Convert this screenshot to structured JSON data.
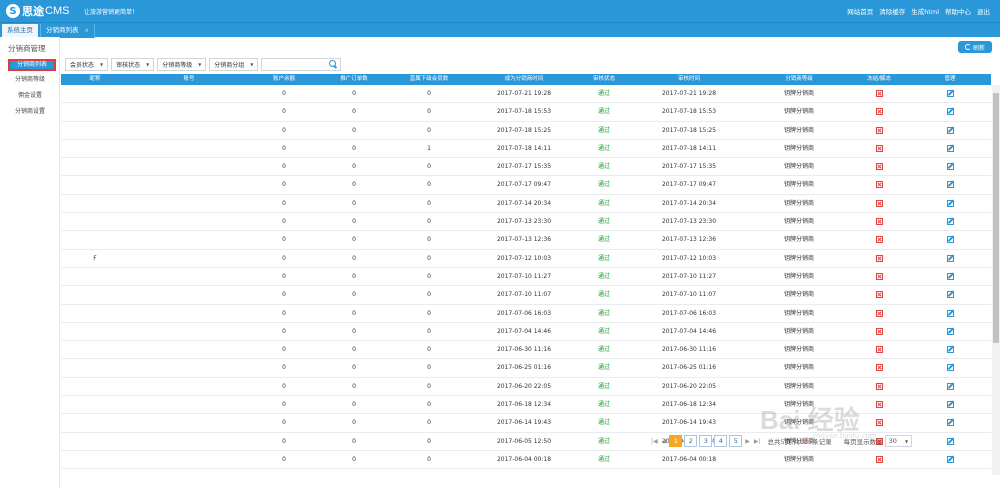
{
  "app": {
    "brand_cn": "思途",
    "brand_en": "CMS",
    "slogan": "让旅游营销更简单！",
    "top_links": [
      "网站首页",
      "清除缓存",
      "生成html",
      "帮助中心",
      "退出"
    ]
  },
  "tabs": [
    {
      "label": "系统主页"
    },
    {
      "label": "分销商列表",
      "close": "×"
    }
  ],
  "sidebar": {
    "title": "分销商管理",
    "items": [
      {
        "label": "分销商列表",
        "active": true
      },
      {
        "label": "分销商等级"
      },
      {
        "label": "佣金设置"
      },
      {
        "label": "分销商设置"
      }
    ]
  },
  "toolbar": {
    "refresh_label": "刷新",
    "filters": [
      "会员状态",
      "审核状态",
      "分销商等级",
      "分销商分组"
    ],
    "search_placeholder": ""
  },
  "table": {
    "headers": [
      "昵称",
      "账号",
      "账户余额",
      "推广订单数",
      "直属下级会员数",
      "成为分销商时间",
      "审核状态",
      "审核时间",
      "分销商等级",
      "冻结/解冻",
      "管理"
    ],
    "rows": [
      {
        "nick": "",
        "account": "",
        "balance": "0",
        "orders": "0",
        "subs": "0",
        "joined": "2017-07-21 19:28",
        "status": "通过",
        "audit": "2017-07-21 19:28",
        "level": "钥牌分销商"
      },
      {
        "nick": "",
        "account": "",
        "balance": "0",
        "orders": "0",
        "subs": "0",
        "joined": "2017-07-18 15:53",
        "status": "通过",
        "audit": "2017-07-18 15:53",
        "level": "钥牌分销商"
      },
      {
        "nick": "",
        "account": "",
        "balance": "0",
        "orders": "0",
        "subs": "0",
        "joined": "2017-07-18 15:25",
        "status": "通过",
        "audit": "2017-07-18 15:25",
        "level": "钥牌分销商"
      },
      {
        "nick": "",
        "account": "",
        "balance": "0",
        "orders": "0",
        "subs": "1",
        "joined": "2017-07-18 14:11",
        "status": "通过",
        "audit": "2017-07-18 14:11",
        "level": "钥牌分销商"
      },
      {
        "nick": "",
        "account": "",
        "balance": "0",
        "orders": "0",
        "subs": "0",
        "joined": "2017-07-17 15:35",
        "status": "通过",
        "audit": "2017-07-17 15:35",
        "level": "钥牌分销商"
      },
      {
        "nick": "",
        "account": "",
        "balance": "0",
        "orders": "0",
        "subs": "0",
        "joined": "2017-07-17 09:47",
        "status": "通过",
        "audit": "2017-07-17 09:47",
        "level": "钥牌分销商"
      },
      {
        "nick": "",
        "account": "",
        "balance": "0",
        "orders": "0",
        "subs": "0",
        "joined": "2017-07-14 20:34",
        "status": "通过",
        "audit": "2017-07-14 20:34",
        "level": "钥牌分销商"
      },
      {
        "nick": "",
        "account": "",
        "balance": "0",
        "orders": "0",
        "subs": "0",
        "joined": "2017-07-13 23:30",
        "status": "通过",
        "audit": "2017-07-13 23:30",
        "level": "钥牌分销商"
      },
      {
        "nick": "",
        "account": "",
        "balance": "0",
        "orders": "0",
        "subs": "0",
        "joined": "2017-07-13 12:36",
        "status": "通过",
        "audit": "2017-07-13 12:36",
        "level": "钥牌分销商"
      },
      {
        "nick": "F",
        "account": "",
        "balance": "0",
        "orders": "0",
        "subs": "0",
        "joined": "2017-07-12 10:03",
        "status": "通过",
        "audit": "2017-07-12 10:03",
        "level": "钥牌分销商"
      },
      {
        "nick": "",
        "account": "",
        "balance": "0",
        "orders": "0",
        "subs": "0",
        "joined": "2017-07-10 11:27",
        "status": "通过",
        "audit": "2017-07-10 11:27",
        "level": "钥牌分销商"
      },
      {
        "nick": "",
        "account": "",
        "balance": "0",
        "orders": "0",
        "subs": "0",
        "joined": "2017-07-10 11:07",
        "status": "通过",
        "audit": "2017-07-10 11:07",
        "level": "钥牌分销商"
      },
      {
        "nick": "",
        "account": "",
        "balance": "0",
        "orders": "0",
        "subs": "0",
        "joined": "2017-07-06 16:03",
        "status": "通过",
        "audit": "2017-07-06 16:03",
        "level": "钥牌分销商"
      },
      {
        "nick": "",
        "account": "",
        "balance": "0",
        "orders": "0",
        "subs": "0",
        "joined": "2017-07-04 14:46",
        "status": "通过",
        "audit": "2017-07-04 14:46",
        "level": "钥牌分销商"
      },
      {
        "nick": "",
        "account": "",
        "balance": "0",
        "orders": "0",
        "subs": "0",
        "joined": "2017-06-30 11:16",
        "status": "通过",
        "audit": "2017-06-30 11:16",
        "level": "钥牌分销商"
      },
      {
        "nick": "",
        "account": "",
        "balance": "0",
        "orders": "0",
        "subs": "0",
        "joined": "2017-06-25 01:16",
        "status": "通过",
        "audit": "2017-06-25 01:16",
        "level": "钥牌分销商"
      },
      {
        "nick": "",
        "account": "",
        "balance": "0",
        "orders": "0",
        "subs": "0",
        "joined": "2017-06-20 22:05",
        "status": "通过",
        "audit": "2017-06-20 22:05",
        "level": "钥牌分销商"
      },
      {
        "nick": "",
        "account": "",
        "balance": "0",
        "orders": "0",
        "subs": "0",
        "joined": "2017-06-18 12:34",
        "status": "通过",
        "audit": "2017-06-18 12:34",
        "level": "钥牌分销商"
      },
      {
        "nick": "",
        "account": "",
        "balance": "0",
        "orders": "0",
        "subs": "0",
        "joined": "2017-06-14 19:43",
        "status": "通过",
        "audit": "2017-06-14 19:43",
        "level": "钥牌分销商"
      },
      {
        "nick": "",
        "account": "",
        "balance": "0",
        "orders": "0",
        "subs": "0",
        "joined": "2017-06-05 12:50",
        "status": "通过",
        "audit": "2017-06-05 12:50",
        "level": "钥牌分销商"
      },
      {
        "nick": "",
        "account": "",
        "balance": "0",
        "orders": "0",
        "subs": "0",
        "joined": "2017-06-04 00:18",
        "status": "通过",
        "audit": "2017-06-04 00:18",
        "level": "钥牌分销商"
      }
    ]
  },
  "pager": {
    "pages": [
      "1",
      "2",
      "3",
      "4",
      "5"
    ],
    "current": "1",
    "total_prefix": "总共",
    "total_pages": "5",
    "total_mid": "页,共",
    "total_records": "125",
    "total_suffix": "条记录",
    "page_size_label": "每页显示数量",
    "page_size": "30"
  },
  "watermark": {
    "main": "Bai 经验",
    "sub": "jingyan.baidu.com"
  },
  "colors": {
    "accent": "#2a97d8",
    "status_ok": "#1a9a2a",
    "danger": "#e04444",
    "pager_current": "#f6a623"
  },
  "icons": {
    "freeze": "x-box-icon",
    "manage": "edit-icon",
    "search": "search-icon",
    "refresh": "refresh-icon"
  }
}
